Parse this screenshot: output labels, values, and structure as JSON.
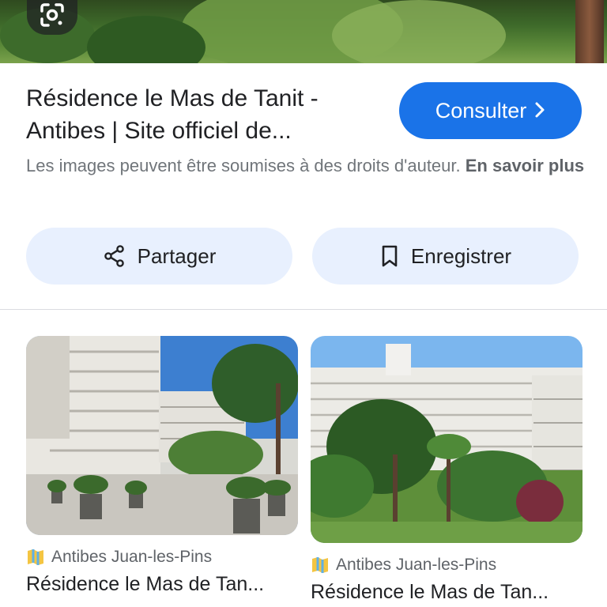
{
  "result": {
    "title": "Résidence le Mas de Tanit - Antibes | Site officiel de...",
    "visit_label": "Consulter",
    "rights_text": "Les images peuvent être soumises à des droits d'auteur.",
    "learn_more": "En savoir plus",
    "share_label": "Partager",
    "save_label": "Enregistrer"
  },
  "related": [
    {
      "source": "Antibes Juan-les-Pins",
      "caption": "Résidence le Mas de Tan..."
    },
    {
      "source": "Antibes Juan-les-Pins",
      "caption": "Résidence le Mas de Tan..."
    }
  ],
  "colors": {
    "accent": "#1a73e8",
    "chip_bg": "#e8f0fe",
    "muted_text": "#70757a"
  },
  "icons": [
    "google-lens-icon",
    "chevron-right-icon",
    "share-icon",
    "bookmark-icon",
    "site-favicon-icon"
  ]
}
